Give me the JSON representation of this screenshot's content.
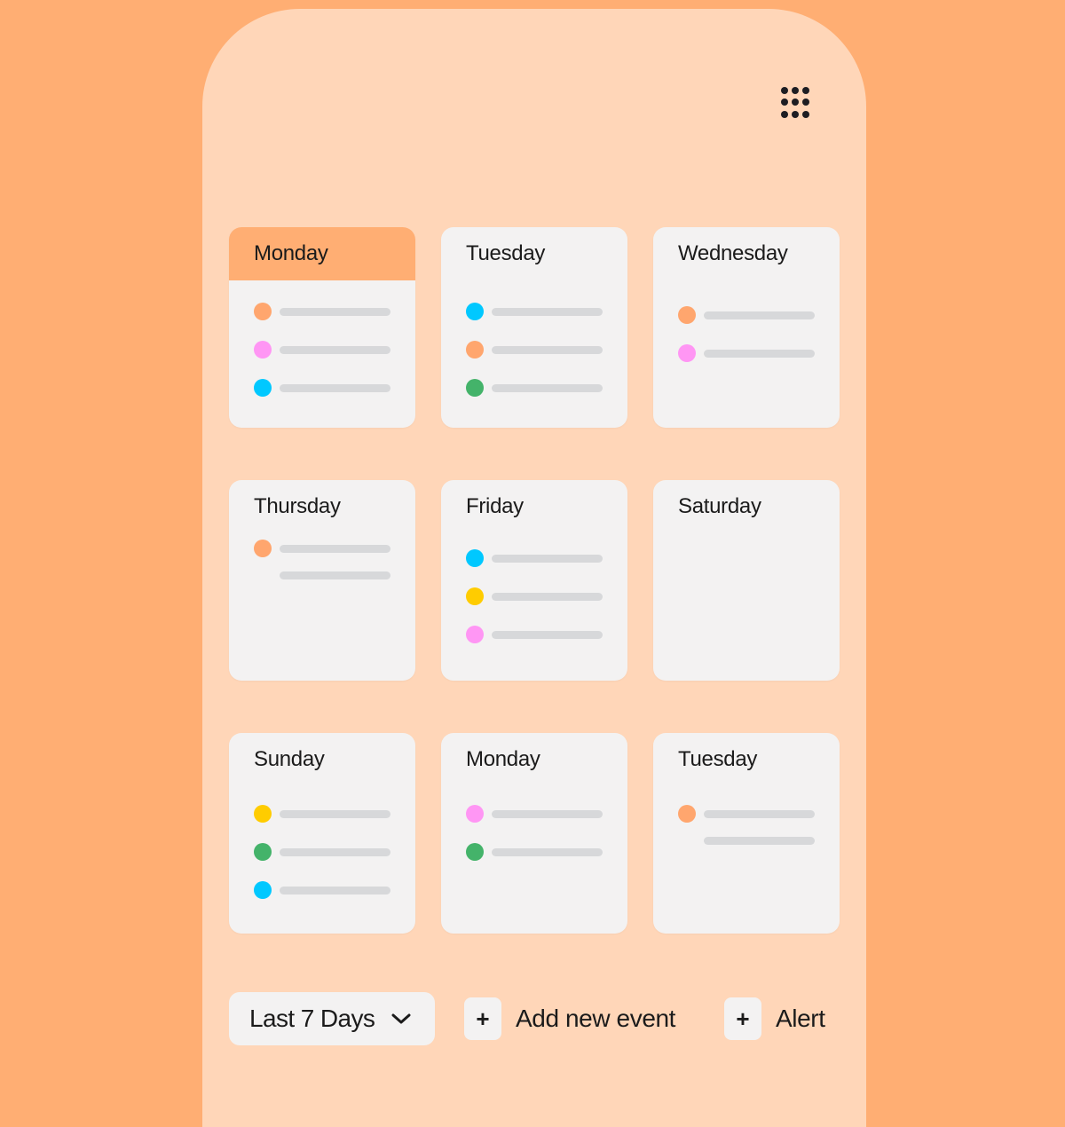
{
  "app": {
    "menu_icon": "grid-dots-icon"
  },
  "colors": {
    "background": "#FFAE73",
    "phone": "#FFD6B8",
    "card": "#F3F2F2",
    "active_header": "#FFAE73",
    "bar": "#D7D8DA",
    "orange": "#FFA66E",
    "pink": "#FF96F4",
    "cyan": "#00C8FF",
    "green": "#44B36A",
    "yellow": "#FFCC00"
  },
  "days": [
    {
      "label": "Monday",
      "active": true,
      "events": [
        {
          "color": "orange"
        },
        {
          "color": "pink"
        },
        {
          "color": "cyan"
        }
      ]
    },
    {
      "label": "Tuesday",
      "active": false,
      "events": [
        {
          "color": "cyan"
        },
        {
          "color": "orange"
        },
        {
          "color": "green"
        }
      ]
    },
    {
      "label": "Wednesday",
      "active": false,
      "events": [
        {
          "color": "orange"
        },
        {
          "color": "pink"
        }
      ]
    },
    {
      "label": "Thursday",
      "active": false,
      "events": [
        {
          "color": "orange"
        },
        {
          "color": null
        }
      ]
    },
    {
      "label": "Friday",
      "active": false,
      "events": [
        {
          "color": "cyan"
        },
        {
          "color": "yellow"
        },
        {
          "color": "pink"
        }
      ]
    },
    {
      "label": "Saturday",
      "active": false,
      "events": []
    },
    {
      "label": "Sunday",
      "active": false,
      "events": [
        {
          "color": "yellow"
        },
        {
          "color": "green"
        },
        {
          "color": "cyan"
        }
      ]
    },
    {
      "label": "Monday",
      "active": false,
      "events": [
        {
          "color": "pink"
        },
        {
          "color": "green"
        }
      ]
    },
    {
      "label": "Tuesday",
      "active": false,
      "events": [
        {
          "color": "orange"
        },
        {
          "color": null
        }
      ]
    }
  ],
  "footer": {
    "range_select": {
      "value": "Last 7 Days"
    },
    "add_event": {
      "icon": "+",
      "label": "Add new event"
    },
    "alert": {
      "icon": "+",
      "label": "Alert"
    }
  }
}
